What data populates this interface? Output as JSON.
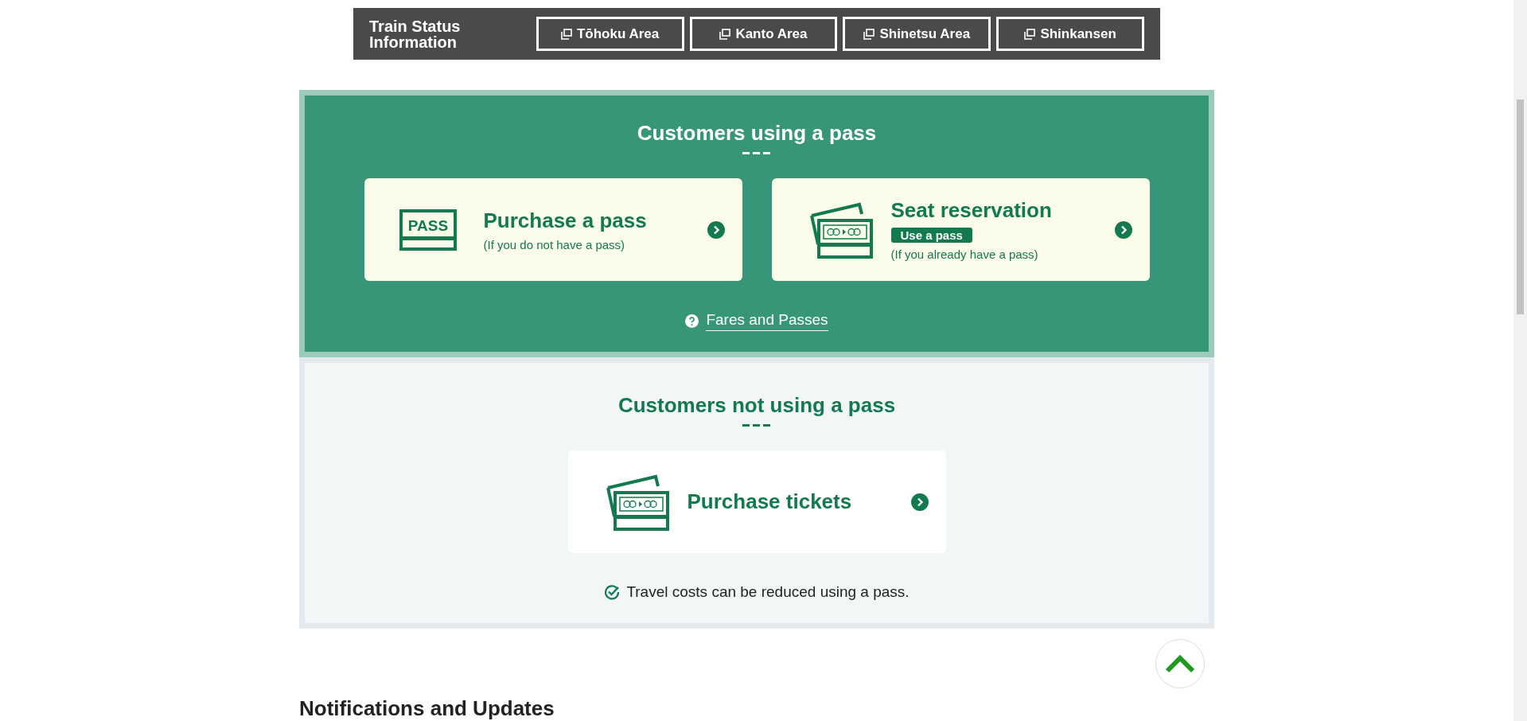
{
  "train_status": {
    "title": "Train Status Information",
    "links": [
      {
        "label": "Tōhoku Area"
      },
      {
        "label": "Kanto Area"
      },
      {
        "label": "Shinetsu Area"
      },
      {
        "label": "Shinkansen"
      }
    ]
  },
  "pass_section": {
    "title": "Customers using a pass",
    "cards": [
      {
        "kind": "pass",
        "icon_text": "PASS",
        "title": "Purchase a pass",
        "note": "(If you do not have a pass)"
      },
      {
        "kind": "ticket",
        "title": "Seat reservation",
        "badge": "Use a pass",
        "note": "(If you already have a pass)"
      }
    ],
    "help_link": "Fares and Passes"
  },
  "no_pass_section": {
    "title": "Customers not using a pass",
    "cards": [
      {
        "kind": "ticket",
        "title": "Purchase tickets"
      }
    ],
    "tip": "Travel costs can be reduced using a pass."
  },
  "notifications": {
    "heading": "Notifications and Updates"
  }
}
